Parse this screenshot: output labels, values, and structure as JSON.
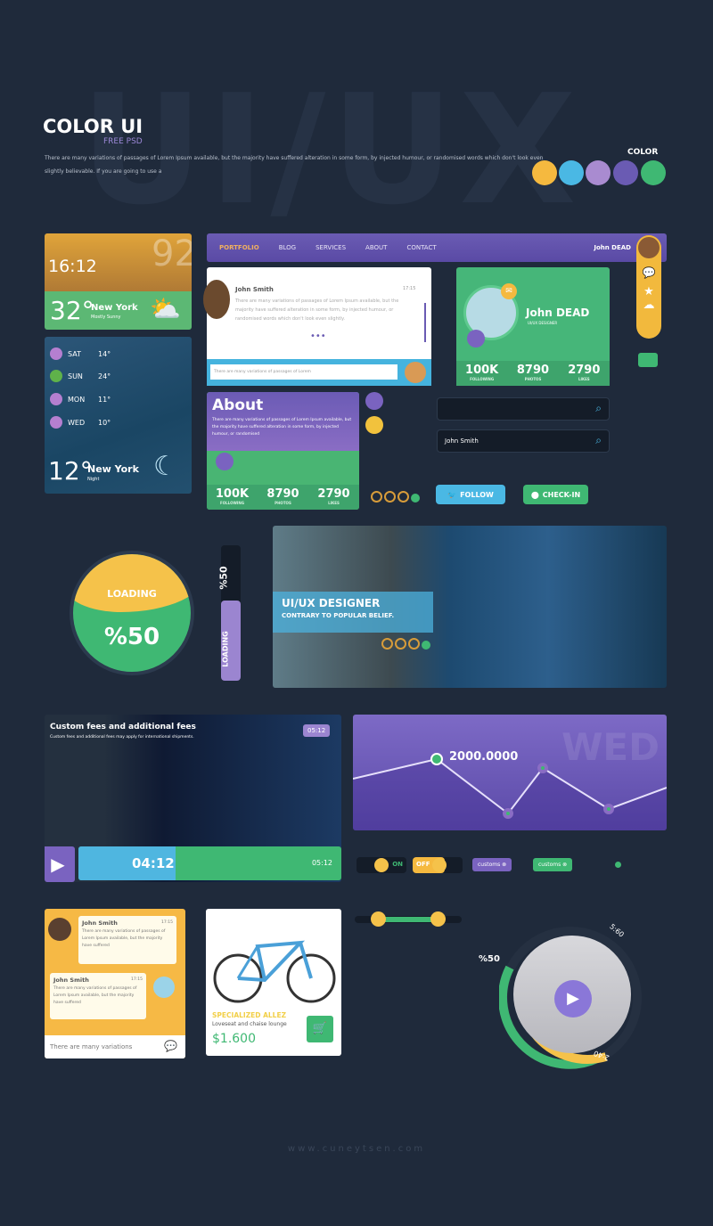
{
  "header": {
    "watermark": "UI/UX",
    "title": "COLOR UI",
    "subtitle": "FREE PSD",
    "description": "There are many variations of passages of Lorem Ipsum available, but the majority have suffered alteration in some form, by injected humour, or randomised words which don't look even slightly believable. If you are going to use a",
    "color_label": "COLOR",
    "swatches": [
      "#f5b93f",
      "#4ab8e4",
      "#a98bd0",
      "#6a5bb3",
      "#3fb873"
    ]
  },
  "weather_day": {
    "time": "16:12",
    "bg_temp": "92°",
    "temp": "32°",
    "city": "New York",
    "condition": "Mostly Sunny"
  },
  "weather_week": {
    "days": [
      {
        "day": "SAT",
        "temp": "14°"
      },
      {
        "day": "SUN",
        "temp": "24°"
      },
      {
        "day": "MON",
        "temp": "11°"
      },
      {
        "day": "WED",
        "temp": "10°"
      }
    ],
    "temp": "12°",
    "city": "New York",
    "condition": "Night"
  },
  "nav": {
    "items": [
      "PORTFOLIO",
      "BLOG",
      "SERVICES",
      "ABOUT",
      "CONTACT"
    ],
    "user": "John DEAD"
  },
  "message": {
    "name": "John Smith",
    "time": "17:15",
    "text": "There are many variations of passages of Lorem Ipsum available, but the majority have suffered alteration in some form, by injected humour, or randomised words which don't look even slightly.",
    "more": "•••",
    "reply_placeholder": "There are many variations of passages of Lorem"
  },
  "profile": {
    "name": "John DEAD",
    "role": "UI/UX DESIGNER",
    "stats": [
      {
        "value": "100K",
        "label": "FOLLOWING"
      },
      {
        "value": "8790",
        "label": "PHOTOS"
      },
      {
        "value": "2790",
        "label": "LIKES"
      }
    ]
  },
  "about": {
    "title": "About",
    "text": "There are many variations of passages of Lorem Ipsum available, but the majority have suffered alteration in some form, by injected humour, or randomised",
    "stats": [
      {
        "value": "100K",
        "label": "FOLLOWING"
      },
      {
        "value": "8790",
        "label": "PHOTOS"
      },
      {
        "value": "2790",
        "label": "LIKES"
      }
    ]
  },
  "search": {
    "empty_value": "",
    "filled_value": "John Smith"
  },
  "buttons": {
    "follow": "FOLLOW",
    "checkin": "CHECK-IN"
  },
  "loading": {
    "label": "LOADING",
    "percent": "%50",
    "value": 50,
    "vertical_percent": "%50",
    "vertical_label": "LOADING"
  },
  "hero": {
    "title": "UI/UX DESIGNER",
    "subtitle": "CONTRARY TO POPULAR BELIEF."
  },
  "video": {
    "title": "Custom fees and additional fees",
    "subtitle": "Custom fees and additional fees may apply for international shipments.",
    "badge": "05:12",
    "current": "04:12",
    "total": "05:12",
    "progress": 0.37
  },
  "graph": {
    "bg_label": "WED",
    "value_label": "2000.0000"
  },
  "toggles": {
    "on": "ON",
    "off": "OFF",
    "tag": "customs"
  },
  "chat": {
    "messages": [
      {
        "name": "John Smith",
        "time": "17:15",
        "text": "There are many variations of passages of Lorem Ipsum available, but the majority have suffered"
      },
      {
        "name": "John Smith",
        "time": "17:15",
        "text": "There are many variations of passages of Lorem Ipsum available, but the majority have suffered"
      }
    ],
    "input": "There are many variations"
  },
  "product": {
    "name": "SPECIALIZED ALLEZ",
    "desc": "Loveseat and chaise lounge",
    "price": "$1.600"
  },
  "player": {
    "percent": "%50",
    "start": "2:40",
    "end": "5:60"
  },
  "footer": "www.cuneytsen.com"
}
